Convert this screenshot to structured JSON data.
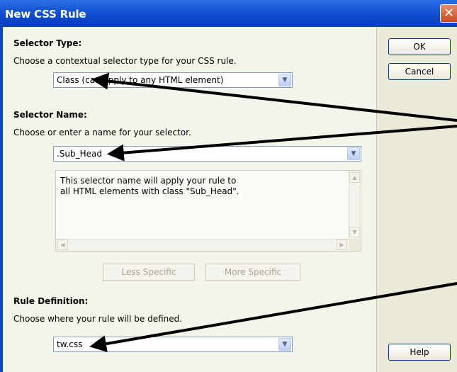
{
  "window": {
    "title": "New CSS Rule",
    "close_glyph": "✕"
  },
  "selector_type": {
    "heading": "Selector Type:",
    "description": "Choose a contextual selector type for your CSS rule.",
    "value": "Class (can apply to any HTML element)"
  },
  "selector_name": {
    "heading": "Selector Name:",
    "description": "Choose or enter a name for your selector.",
    "value": ".Sub_Head",
    "info": "This selector name will apply your rule to\nall HTML elements with class \"Sub_Head\"."
  },
  "specificity": {
    "less_label": "Less Specific",
    "more_label": "More Specific"
  },
  "rule_definition": {
    "heading": "Rule Definition:",
    "description": "Choose where your rule will be defined.",
    "value": "tw.css"
  },
  "buttons": {
    "ok": "OK",
    "cancel": "Cancel",
    "help": "Help"
  },
  "icons": {
    "dropdown": "chevron-down-icon",
    "close": "close-icon"
  },
  "colors": {
    "titlebar": "#0b46c8",
    "dialog": "#ece9d8",
    "arrow": "#000000"
  }
}
